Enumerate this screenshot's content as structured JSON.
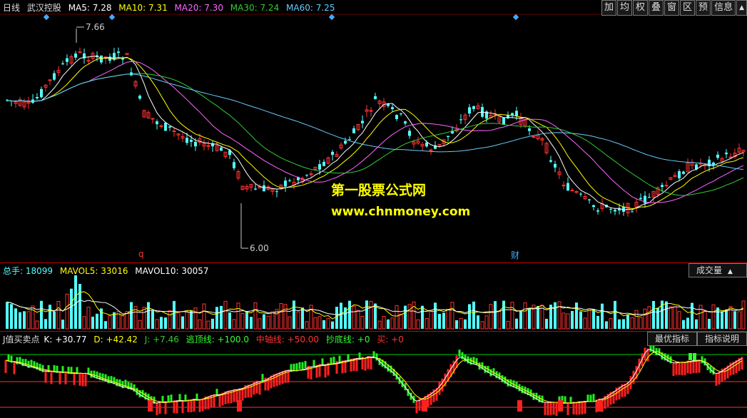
{
  "main": {
    "period": "日线",
    "stock": "武汉控股",
    "ma": [
      {
        "label": "MA5: 7.28",
        "color": "#ffffff"
      },
      {
        "label": "MA10: 7.31",
        "color": "#ffff00"
      },
      {
        "label": "MA20: 7.30",
        "color": "#ff66ff"
      },
      {
        "label": "MA30: 7.24",
        "color": "#33cc33"
      },
      {
        "label": "MA60: 7.25",
        "color": "#66ccff"
      }
    ],
    "high_label": "7.66",
    "low_label": "6.00",
    "marker_q": "q",
    "marker_cai": "财"
  },
  "toolbar": [
    "加",
    "均",
    "权",
    "叠",
    "窗",
    "区",
    "预",
    "信息",
    "▲"
  ],
  "watermark": {
    "line1": "第一股票公式网",
    "line2": "www.chnmoney.com"
  },
  "volume": {
    "label": "总手: 18099",
    "mavol5": "MAVOL5: 33016",
    "mavol10": "MAVOL10: 30057",
    "selector": "成交量"
  },
  "indicator": {
    "name": "J值买卖点",
    "k": "K: +30.77",
    "d": "D: +42.42",
    "j": "J: +7.46",
    "top": "逃顶线: +100.0",
    "mid": "中轴线: +50.00",
    "bottom": "抄底线: +0",
    "buy": "买: +0",
    "btn_best": "最优指标",
    "btn_help": "指标说明"
  },
  "colors": {
    "up": "#ff3232",
    "down": "#54ffff",
    "ma5": "#ffffff",
    "ma10": "#ffff00",
    "ma20": "#ff66ff",
    "ma30": "#33cc33",
    "ma60": "#66ccff"
  }
}
